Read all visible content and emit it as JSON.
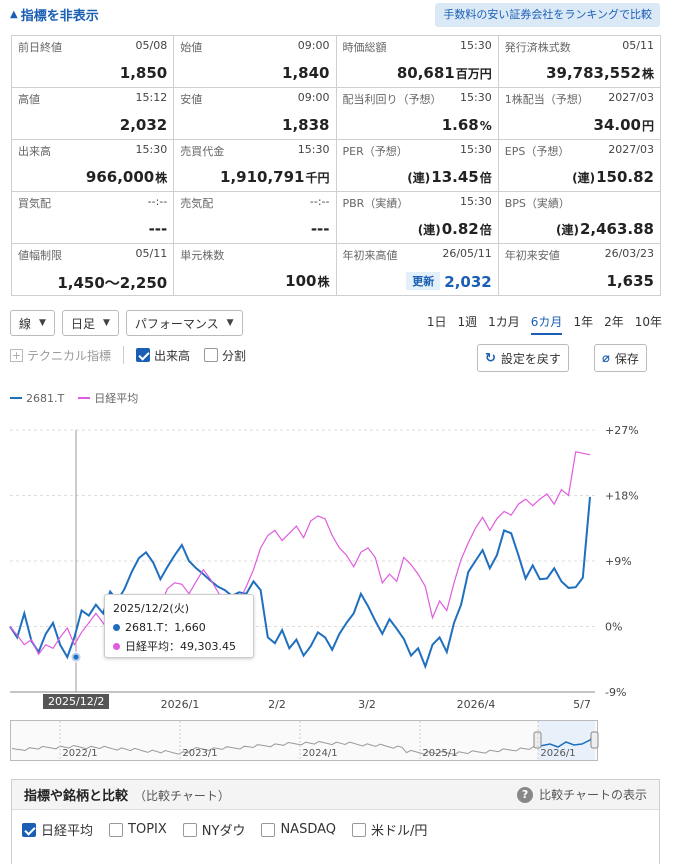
{
  "header": {
    "toggle_label": "指標を非表示",
    "ranking_button": "手数料の安い証券会社をランキングで比較"
  },
  "stats": [
    [
      {
        "label": "前日終値",
        "time": "05/08",
        "value": "1,850",
        "unit": "",
        "prefix": ""
      },
      {
        "label": "始値",
        "time": "09:00",
        "value": "1,840",
        "unit": "",
        "prefix": ""
      },
      {
        "label": "時価総額",
        "time": "15:30",
        "value": "80,681",
        "unit": "百万円",
        "prefix": ""
      },
      {
        "label": "発行済株式数",
        "time": "05/11",
        "value": "39,783,552",
        "unit": "株",
        "prefix": ""
      }
    ],
    [
      {
        "label": "高値",
        "time": "15:12",
        "value": "2,032",
        "unit": "",
        "prefix": ""
      },
      {
        "label": "安値",
        "time": "09:00",
        "value": "1,838",
        "unit": "",
        "prefix": ""
      },
      {
        "label": "配当利回り（予想）",
        "time": "15:30",
        "value": "1.68",
        "unit": "%",
        "prefix": ""
      },
      {
        "label": "1株配当（予想）",
        "time": "2027/03",
        "value": "34.00",
        "unit": "円",
        "prefix": ""
      }
    ],
    [
      {
        "label": "出来高",
        "time": "15:30",
        "value": "966,000",
        "unit": "株",
        "prefix": ""
      },
      {
        "label": "売買代金",
        "time": "15:30",
        "value": "1,910,791",
        "unit": "千円",
        "prefix": ""
      },
      {
        "label": "PER（予想）",
        "time": "15:30",
        "value": "13.45",
        "unit": "倍",
        "prefix": "(連)"
      },
      {
        "label": "EPS（予想）",
        "time": "2027/03",
        "value": "150.82",
        "unit": "",
        "prefix": "(連)"
      }
    ],
    [
      {
        "label": "買気配",
        "time": "--:--",
        "value": "---",
        "unit": "",
        "prefix": ""
      },
      {
        "label": "売気配",
        "time": "--:--",
        "value": "---",
        "unit": "",
        "prefix": ""
      },
      {
        "label": "PBR（実績）",
        "time": "15:30",
        "value": "0.82",
        "unit": "倍",
        "prefix": "(連)"
      },
      {
        "label": "BPS（実績）",
        "time": "",
        "value": "2,463.88",
        "unit": "",
        "prefix": "(連)"
      }
    ],
    [
      {
        "label": "値幅制限",
        "time": "05/11",
        "value": "1,450～2,250",
        "unit": "",
        "prefix": ""
      },
      {
        "label": "単元株数",
        "time": "",
        "value": "100",
        "unit": "株",
        "prefix": ""
      },
      {
        "label": "年初来高値",
        "time": "26/05/11",
        "value": "2,032",
        "unit": "",
        "prefix": "",
        "badge": "更新"
      },
      {
        "label": "年初来安値",
        "time": "26/03/23",
        "value": "1,635",
        "unit": "",
        "prefix": ""
      }
    ]
  ],
  "controls": {
    "line_select": "線",
    "interval_select": "日足",
    "mode_select": "パフォーマンス",
    "periods": [
      "1日",
      "1週",
      "1カ月",
      "6カ月",
      "1年",
      "2年",
      "10年"
    ],
    "active_period": "6カ月",
    "technical_label": "テクニカル指標",
    "volume_label": "出来高",
    "split_label": "分割",
    "reset_button": "設定を戻す",
    "save_button": "保存"
  },
  "tooltip": {
    "date": "2025/12/2(火)",
    "stock_line": "2681.T：1,660",
    "index_line": "日経平均：49,303.45"
  },
  "crosshair_date": "2025/12/2",
  "navigator_labels": [
    "2022/1",
    "2023/1",
    "2024/1",
    "2025/1",
    "2026/1"
  ],
  "colors": {
    "stock": "#1f6fbf",
    "index": "#e05be0",
    "accent": "#1a5fb4"
  },
  "chart_data": {
    "type": "line",
    "ylim": [
      -9,
      27
    ],
    "y_ticks": [
      "+27%",
      "+18%",
      "+9%",
      "0%",
      "-9%"
    ],
    "x_tick_labels": [
      "2026/1",
      "2/2",
      "3/2",
      "2026/4",
      "5/7"
    ],
    "series": [
      {
        "name": "2681.T",
        "color": "#1f6fbf",
        "values": [
          0.0,
          -1.5,
          1.8,
          -2.0,
          -3.5,
          -1.0,
          0.5,
          -2.5,
          -4.2,
          -1.5,
          2.2,
          1.5,
          3.0,
          1.8,
          4.8,
          3.5,
          5.2,
          7.5,
          9.4,
          10.2,
          8.8,
          6.5,
          8.2,
          9.8,
          11.2,
          9.0,
          8.0,
          7.2,
          6.3,
          5.5,
          5.0,
          4.2,
          4.7,
          4.5,
          6.2,
          5.0,
          -1.5,
          -2.3,
          -0.5,
          -3.0,
          -1.8,
          -4.0,
          -2.7,
          -0.8,
          -1.5,
          -3.2,
          -1.0,
          0.5,
          1.8,
          4.5,
          2.8,
          0.8,
          -1.0,
          1.0,
          -0.3,
          -1.7,
          -4.0,
          -3.0,
          -5.5,
          -2.5,
          -1.5,
          -3.5,
          0.5,
          3.0,
          7.5,
          9.0,
          10.5,
          8.0,
          9.8,
          13.2,
          12.8,
          9.8,
          6.6,
          8.4,
          6.5,
          6.6,
          8.0,
          6.2,
          5.3,
          5.4,
          6.7,
          17.8
        ]
      },
      {
        "name": "日経平均",
        "color": "#e05be0",
        "values": [
          0.0,
          -1.2,
          -2.5,
          -1.8,
          -3.8,
          -2.5,
          -3.0,
          -1.5,
          -0.2,
          -2.5,
          -0.8,
          0.5,
          1.8,
          0.5,
          -1.0,
          -2.5,
          -3.2,
          -1.8,
          -2.0,
          -0.5,
          1.5,
          3.0,
          5.2,
          6.0,
          5.8,
          4.5,
          6.2,
          7.8,
          6.5,
          4.8,
          3.0,
          4.2,
          3.5,
          5.5,
          7.8,
          10.8,
          12.5,
          13.2,
          11.8,
          12.8,
          13.8,
          12.2,
          14.5,
          15.2,
          14.8,
          12.5,
          10.8,
          9.8,
          8.2,
          10.2,
          10.8,
          9.5,
          6.0,
          7.2,
          6.2,
          9.5,
          8.5,
          7.2,
          5.5,
          1.2,
          3.5,
          2.2,
          6.0,
          9.2,
          11.5,
          13.5,
          15.0,
          13.2,
          14.8,
          15.8,
          15.3,
          16.8,
          17.5,
          16.6,
          17.5,
          18.2,
          16.8,
          18.8,
          18.0,
          24.0,
          23.8,
          23.6
        ]
      }
    ]
  },
  "compare": {
    "title": "指標や銘柄と比較",
    "subtitle": "（比較チャート）",
    "help_label": "比較チャートの表示",
    "items": [
      {
        "label": "日経平均",
        "checked": true
      },
      {
        "label": "TOPIX",
        "checked": false
      },
      {
        "label": "NYダウ",
        "checked": false
      },
      {
        "label": "NASDAQ",
        "checked": false
      },
      {
        "label": "米ドル/円",
        "checked": false
      }
    ]
  }
}
